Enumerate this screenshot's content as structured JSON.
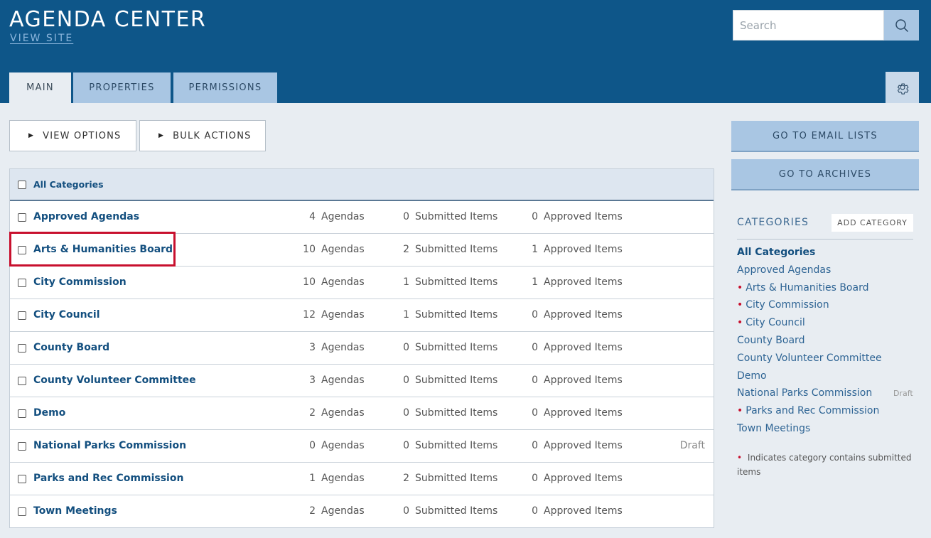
{
  "header": {
    "title": "AGENDA CENTER",
    "view_site": "VIEW SITE"
  },
  "search": {
    "placeholder": "Search"
  },
  "tabs": [
    {
      "label": "MAIN"
    },
    {
      "label": "PROPERTIES"
    },
    {
      "label": "PERMISSIONS"
    }
  ],
  "toolbar": {
    "view_options": "VIEW OPTIONS",
    "bulk_actions": "BULK ACTIONS"
  },
  "table": {
    "header_label": "All Categories",
    "units": {
      "agendas": "Agendas",
      "submitted": "Submitted Items",
      "approved": "Approved Items"
    },
    "rows": [
      {
        "name": "Approved Agendas",
        "agendas": "4",
        "submitted": "0",
        "approved": "0",
        "status": ""
      },
      {
        "name": "Arts & Humanities Board",
        "agendas": "10",
        "submitted": "2",
        "approved": "1",
        "status": ""
      },
      {
        "name": "City Commission",
        "agendas": "10",
        "submitted": "1",
        "approved": "1",
        "status": ""
      },
      {
        "name": "City Council",
        "agendas": "12",
        "submitted": "1",
        "approved": "0",
        "status": ""
      },
      {
        "name": "County Board",
        "agendas": "3",
        "submitted": "0",
        "approved": "0",
        "status": ""
      },
      {
        "name": "County Volunteer Committee",
        "agendas": "3",
        "submitted": "0",
        "approved": "0",
        "status": ""
      },
      {
        "name": "Demo",
        "agendas": "2",
        "submitted": "0",
        "approved": "0",
        "status": ""
      },
      {
        "name": "National Parks Commission",
        "agendas": "0",
        "submitted": "0",
        "approved": "0",
        "status": "Draft"
      },
      {
        "name": "Parks and Rec Commission",
        "agendas": "1",
        "submitted": "2",
        "approved": "0",
        "status": ""
      },
      {
        "name": "Town Meetings",
        "agendas": "2",
        "submitted": "0",
        "approved": "0",
        "status": ""
      }
    ]
  },
  "sidebar": {
    "email_lists": "GO TO EMAIL LISTS",
    "archives": "GO TO ARCHIVES",
    "categories_title": "CATEGORIES",
    "add_category": "ADD CATEGORY",
    "items": [
      {
        "label": "All Categories",
        "bold": true,
        "dot": false,
        "status": ""
      },
      {
        "label": "Approved Agendas",
        "bold": false,
        "dot": false,
        "status": ""
      },
      {
        "label": "Arts & Humanities Board",
        "bold": false,
        "dot": true,
        "status": ""
      },
      {
        "label": "City Commission",
        "bold": false,
        "dot": true,
        "status": ""
      },
      {
        "label": "City Council",
        "bold": false,
        "dot": true,
        "status": ""
      },
      {
        "label": "County Board",
        "bold": false,
        "dot": false,
        "status": ""
      },
      {
        "label": "County Volunteer Committee",
        "bold": false,
        "dot": false,
        "status": ""
      },
      {
        "label": "Demo",
        "bold": false,
        "dot": false,
        "status": ""
      },
      {
        "label": "National Parks Commission",
        "bold": false,
        "dot": false,
        "status": "Draft"
      },
      {
        "label": "Parks and Rec Commission",
        "bold": false,
        "dot": true,
        "status": ""
      },
      {
        "label": "Town Meetings",
        "bold": false,
        "dot": false,
        "status": ""
      }
    ],
    "legend": "Indicates category contains submitted items"
  },
  "colors": {
    "header_bg": "#0e5689",
    "tab_bg": "#a9c6e3",
    "link": "#134f7f",
    "highlight": "#c8102e",
    "page_bg": "#e8edf2"
  }
}
